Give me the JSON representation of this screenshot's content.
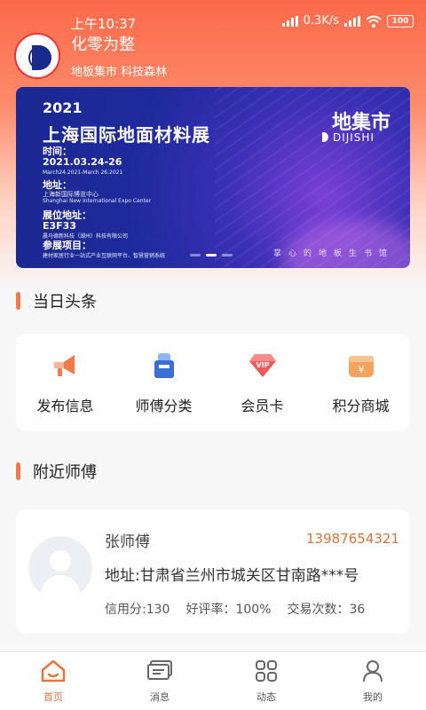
{
  "status_bar": {
    "time": "上午10:37",
    "network_speed": "0.3K/s",
    "battery": "100"
  },
  "header": {
    "app_title": "化零为整",
    "app_subtitle": "地板集市 科技森林"
  },
  "banner": {
    "year": "2021",
    "expo_title": "上海国际地面材料展",
    "time_label": "时间：",
    "time_value": "2021.03.24-26",
    "time_en": "March24.2021-March 26.2021",
    "address_label": "地址：",
    "address_value": "上海新国际博览中心",
    "address_en": "Shanghai New International Expo Center",
    "booth_label": "展位地址：",
    "booth_value": "E3F33",
    "company": "晨马德新科技（湖州）科技有限公司",
    "projects_label": "参展项目：",
    "projects_value": "建材家居行业一站式产业互联网平台、智慧营销系统",
    "brand": "地集市",
    "brand_en": "DIJISHI",
    "slogan": "掌心的地板生书馆",
    "active_slide": 2,
    "slide_count": 3
  },
  "sections": {
    "headlines": "当日头条",
    "nearby": "附近师傅"
  },
  "quick_actions": [
    {
      "label": "发布信息",
      "icon": "megaphone-icon"
    },
    {
      "label": "师傅分类",
      "icon": "worker-icon"
    },
    {
      "label": "会员卡",
      "icon": "vip-icon"
    },
    {
      "label": "积分商城",
      "icon": "points-wallet-icon"
    }
  ],
  "master": {
    "name": "张师傅",
    "phone": "13987654321",
    "address": "地址:甘肃省兰州市城关区甘南路***号",
    "credit": "信用分:130",
    "rating": "好评率：100%",
    "deals": "交易次数：36"
  },
  "tabbar": {
    "tabs": [
      {
        "label": "首页",
        "icon": "home-icon",
        "active": true
      },
      {
        "label": "消息",
        "icon": "message-icon",
        "active": false
      },
      {
        "label": "动态",
        "icon": "grid-icon",
        "active": false
      },
      {
        "label": "我的",
        "icon": "profile-icon",
        "active": false
      }
    ]
  },
  "colors": {
    "accent": "#e7733d",
    "banner_blue": "#1e2a9c",
    "header_gradient": "#fb6a4a"
  }
}
